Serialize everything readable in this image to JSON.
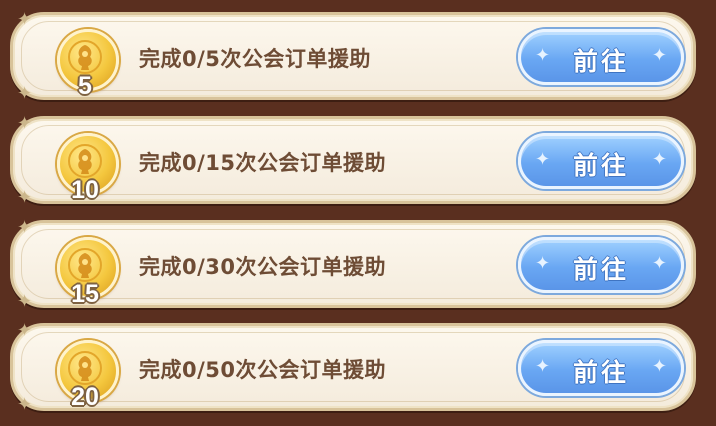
{
  "tasks": [
    {
      "medal_count": "5",
      "text": "完成0/5次公会订单援助",
      "button_label": "前往"
    },
    {
      "medal_count": "10",
      "text": "完成0/15次公会订单援助",
      "button_label": "前往"
    },
    {
      "medal_count": "15",
      "text": "完成0/30次公会订单援助",
      "button_label": "前往"
    },
    {
      "medal_count": "20",
      "text": "完成0/50次公会订单援助",
      "button_label": "前往"
    }
  ],
  "icons": {
    "medal": "guild-coin-icon",
    "button_decor": "sparkle-icon"
  },
  "colors": {
    "background": "#5a2f1f",
    "row_fill": "#fdf8ee",
    "row_border": "#d8c39a",
    "text": "#6e4c35",
    "button": "#69a7f3",
    "medal_gold": "#f4c73e"
  }
}
